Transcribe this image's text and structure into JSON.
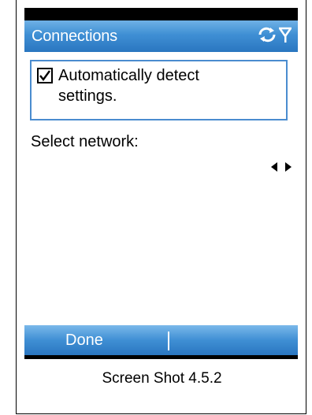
{
  "title_bar": {
    "title": "Connections",
    "icons": [
      "connectivity-icon",
      "signal-strength-icon"
    ]
  },
  "settings": {
    "checkbox_checked": true,
    "checkbox_label_line1": "Automatically detect",
    "checkbox_label_line2": "settings.",
    "select_label": "Select network:",
    "selector_arrows": [
      "left-arrow-icon",
      "right-arrow-icon"
    ]
  },
  "menu_bar": {
    "left_softkey": "Done"
  },
  "caption": "Screen Shot 4.5.2",
  "colors": {
    "title_bar": "#3f8fd4",
    "panel_border": "#4a8ccf",
    "text": "#000000",
    "menu_text": "#ffffff"
  }
}
